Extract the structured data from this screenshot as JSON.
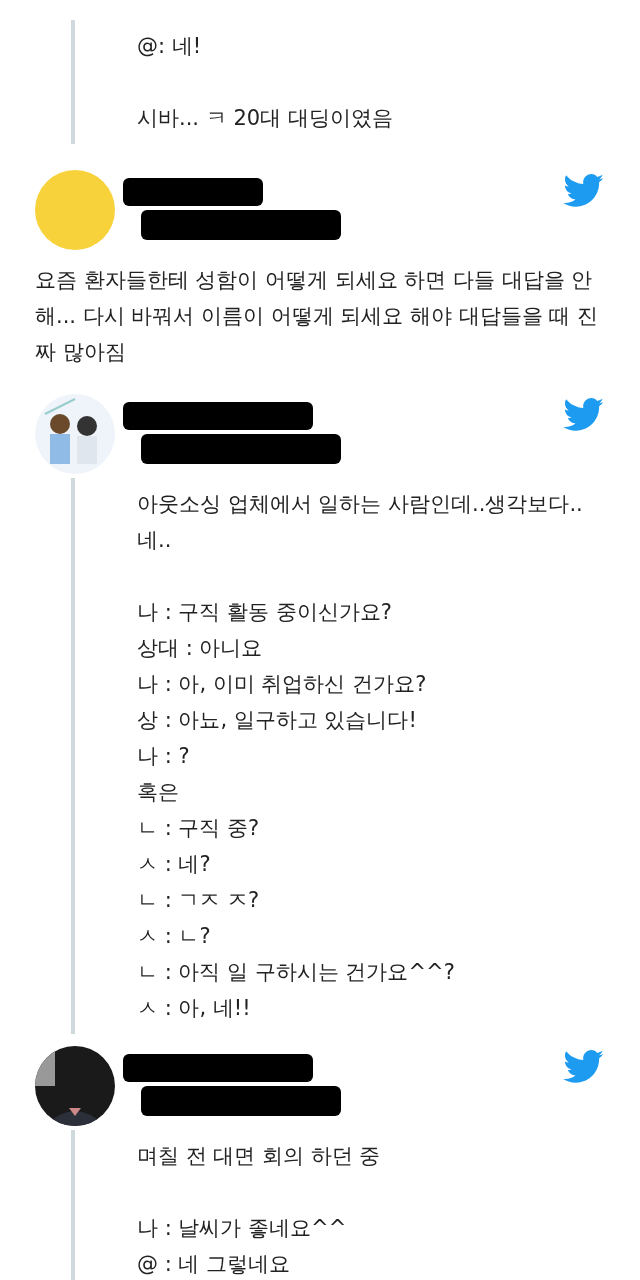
{
  "tweets": [
    {
      "thread_line": true,
      "paragraphs": [
        [
          "@: 네!"
        ],
        [
          "시바... ㅋ 20대 대딩이였음"
        ]
      ]
    },
    {
      "avatar": {
        "kind": "color",
        "color": "#f7d23a"
      },
      "thread_line": false,
      "paragraphs": [
        [
          "요즘 환자들한테 성함이 어떻게 되세요 하면 다들 대답을 안해... 다시 바꿔서 이름이 어떻게 되세요 해야 대답들을 때 진짜 많아짐"
        ]
      ]
    },
    {
      "avatar": {
        "kind": "picture"
      },
      "thread_line": true,
      "paragraphs": [
        [
          "아웃소싱 업체에서 일하는 사람인데..생각보다.. 네.."
        ],
        [
          "나 : 구직 활동 중이신가요?",
          "상대 : 아니요",
          "나 : 아, 이미 취업하신 건가요?",
          "상 : 아뇨, 일구하고 있습니다!",
          "나 : ?",
          "혹은",
          "ㄴ : 구직 중?",
          "ㅅ :  네?",
          "ㄴ : ㄱㅈ ㅈ?",
          "ㅅ : ㄴ?",
          "ㄴ : 아직 일 구하시는 건가요^^?",
          "ㅅ : 아, 네!!"
        ]
      ]
    },
    {
      "avatar": {
        "kind": "picture"
      },
      "thread_line": true,
      "paragraphs": [
        [
          "며칠 전 대면 회의 하던 중"
        ],
        [
          "나 : 날씨가 좋네요^^",
          "@ : 네 그렇네요"
        ]
      ]
    }
  ]
}
